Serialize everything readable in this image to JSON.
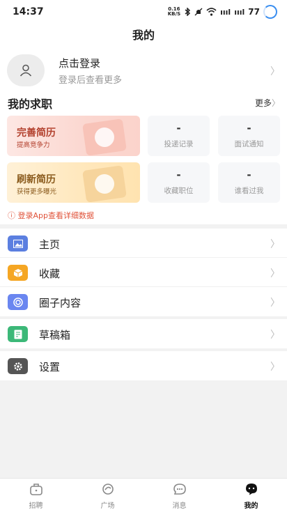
{
  "status_bar": {
    "time": "14:37",
    "net_speed_top": "0.16",
    "net_speed_bottom": "KB/S",
    "sig1": "ıııl",
    "sig2": "ıııl",
    "battery": "77"
  },
  "header": {
    "title": "我的"
  },
  "user": {
    "login_title": "点击登录",
    "login_subtitle": "登录后查看更多"
  },
  "job_section": {
    "title": "我的求职",
    "more_label": "更多",
    "card_resume": {
      "title": "完善简历",
      "subtitle": "提高竞争力"
    },
    "card_refresh": {
      "title": "刷新简历",
      "subtitle": "获得更多曝光"
    },
    "stats": [
      {
        "value": "-",
        "label": "投递记录"
      },
      {
        "value": "-",
        "label": "面试通知"
      },
      {
        "value": "-",
        "label": "收藏职位"
      },
      {
        "value": "-",
        "label": "谁看过我"
      }
    ],
    "notice": "登录App查看详细数据"
  },
  "menu_group1": [
    {
      "label": "主页",
      "icon": "image-icon",
      "color": "#5b7fe0"
    },
    {
      "label": "收藏",
      "icon": "box-icon",
      "color": "#f5a623"
    },
    {
      "label": "圈子内容",
      "icon": "target-icon",
      "color": "#6a86f0"
    }
  ],
  "menu_group2": [
    {
      "label": "草稿箱",
      "icon": "note-icon",
      "color": "#3cb878"
    }
  ],
  "menu_group3": [
    {
      "label": "设置",
      "icon": "gear-icon",
      "color": "#555555"
    }
  ],
  "tabbar": {
    "tabs": [
      {
        "label": "招聘",
        "icon": "bag-icon",
        "active": false
      },
      {
        "label": "广场",
        "icon": "plaza-icon",
        "active": false
      },
      {
        "label": "消息",
        "icon": "message-icon",
        "active": false
      },
      {
        "label": "我的",
        "icon": "profile-icon",
        "active": true
      }
    ]
  }
}
